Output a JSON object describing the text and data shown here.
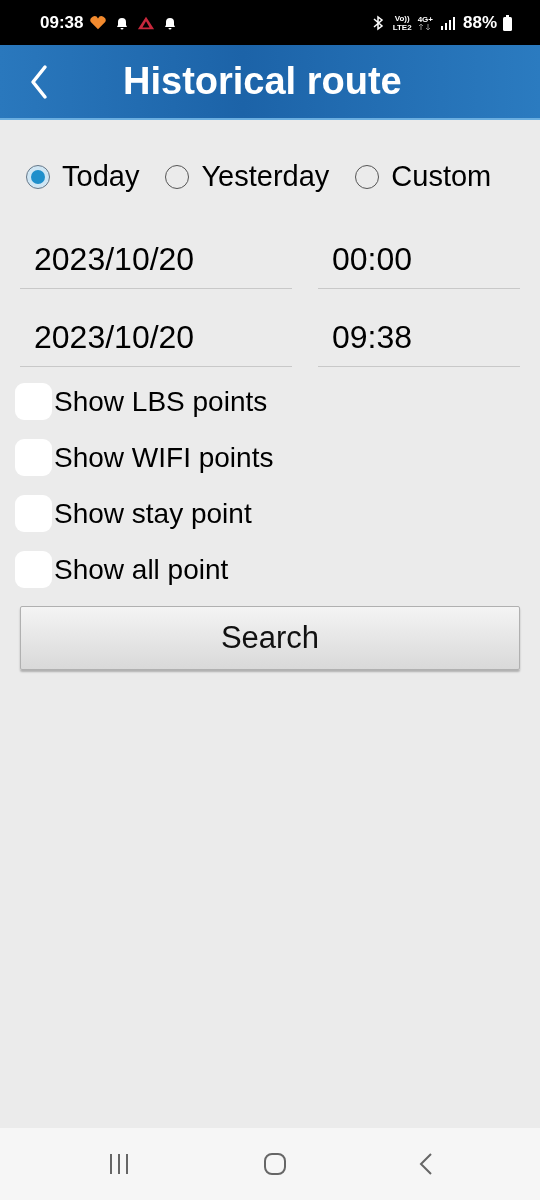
{
  "status_bar": {
    "time": "09:38",
    "volte": "Vo))",
    "lte": "LTE2",
    "network": "4G+",
    "battery": "88%"
  },
  "header": {
    "title": "Historical route"
  },
  "range_options": [
    {
      "label": "Today",
      "selected": true
    },
    {
      "label": "Yesterday",
      "selected": false
    },
    {
      "label": "Custom",
      "selected": false
    }
  ],
  "start": {
    "date": "2023/10/20",
    "time": "00:00"
  },
  "end": {
    "date": "2023/10/20",
    "time": "09:38"
  },
  "options": [
    {
      "label": "Show LBS points",
      "checked": false
    },
    {
      "label": "Show WIFI points",
      "checked": false
    },
    {
      "label": "Show stay point",
      "checked": false
    },
    {
      "label": "Show all point",
      "checked": false
    }
  ],
  "search_button": "Search"
}
